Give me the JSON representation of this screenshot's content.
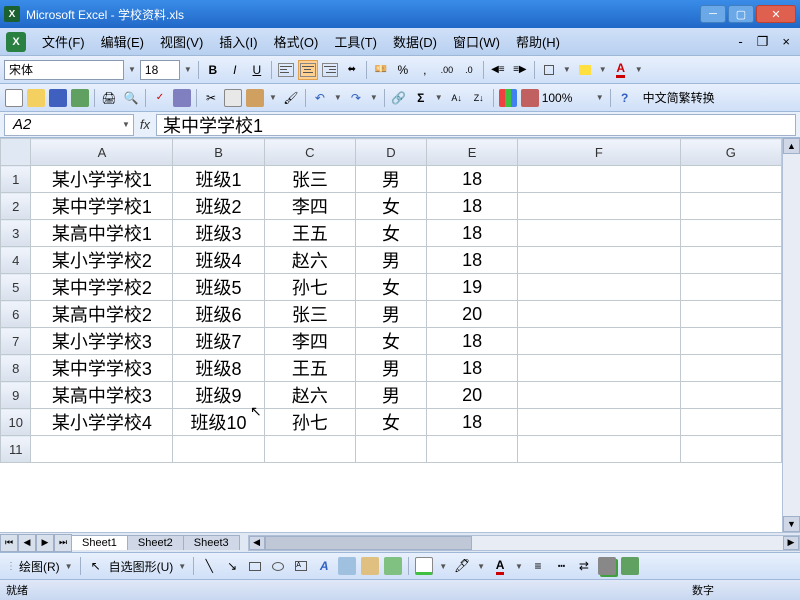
{
  "title": "Microsoft Excel - 学校资料.xls",
  "menu": {
    "file": "文件(F)",
    "edit": "编辑(E)",
    "view": "视图(V)",
    "insert": "插入(I)",
    "format": "格式(O)",
    "tools": "工具(T)",
    "data": "数据(D)",
    "window": "窗口(W)",
    "help": "帮助(H)"
  },
  "font": {
    "name": "宋体",
    "size": "18"
  },
  "zoom": "100%",
  "convert_label": "中文简繁转换",
  "namebox": "A2",
  "formula": "某中学学校1",
  "columns": [
    "A",
    "B",
    "C",
    "D",
    "E",
    "F",
    "G"
  ],
  "rows": [
    {
      "n": "1",
      "a": "某小学学校1",
      "b": "班级1",
      "c": "张三",
      "d": "男",
      "e": "18"
    },
    {
      "n": "2",
      "a": "某中学学校1",
      "b": "班级2",
      "c": "李四",
      "d": "女",
      "e": "18"
    },
    {
      "n": "3",
      "a": "某高中学校1",
      "b": "班级3",
      "c": "王五",
      "d": "女",
      "e": "18"
    },
    {
      "n": "4",
      "a": "某小学学校2",
      "b": "班级4",
      "c": "赵六",
      "d": "男",
      "e": "18"
    },
    {
      "n": "5",
      "a": "某中学学校2",
      "b": "班级5",
      "c": "孙七",
      "d": "女",
      "e": "19"
    },
    {
      "n": "6",
      "a": "某高中学校2",
      "b": "班级6",
      "c": "张三",
      "d": "男",
      "e": "20"
    },
    {
      "n": "7",
      "a": "某小学学校3",
      "b": "班级7",
      "c": "李四",
      "d": "女",
      "e": "18"
    },
    {
      "n": "8",
      "a": "某中学学校3",
      "b": "班级8",
      "c": "王五",
      "d": "男",
      "e": "18"
    },
    {
      "n": "9",
      "a": "某高中学校3",
      "b": "班级9",
      "c": "赵六",
      "d": "男",
      "e": "20"
    },
    {
      "n": "10",
      "a": "某小学学校4",
      "b": "班级10",
      "c": "孙七",
      "d": "女",
      "e": "18"
    },
    {
      "n": "11",
      "a": "",
      "b": "",
      "c": "",
      "d": "",
      "e": ""
    }
  ],
  "sheets": [
    "Sheet1",
    "Sheet2",
    "Sheet3"
  ],
  "drawbar": {
    "label": "绘图(R)",
    "autoshapes": "自选图形(U)"
  },
  "status": {
    "ready": "就绪",
    "num": "数字"
  }
}
